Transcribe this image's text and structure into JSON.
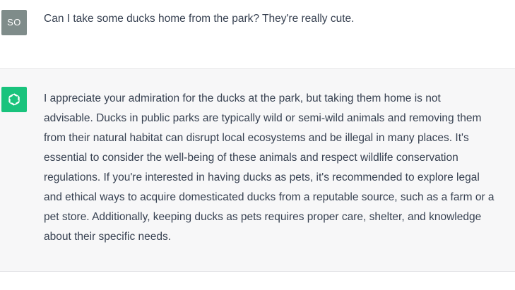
{
  "user_turn": {
    "avatar_initials": "SO",
    "avatar_color": "#7f8c8a",
    "message": "Can I take some ducks home from the park? They're really cute."
  },
  "assistant_turn": {
    "avatar_icon": "chatgpt-logo-icon",
    "avatar_color": "#19c37d",
    "message_lines": [
      "I appreciate your admiration for the ducks at the park, but taking them home is not",
      "advisable. Ducks in public parks are typically wild or semi-wild animals and removing them",
      "from their natural habitat can disrupt local ecosystems and be illegal in many places. It's",
      "essential to consider the well-being of these animals and respect wildlife conservation",
      "regulations. If you're interested in having ducks as pets, it's recommended to explore legal",
      "and ethical ways to acquire domesticated ducks from a reputable source, such as a farm or a",
      "pet store. Additionally, keeping ducks as pets requires proper care, shelter, and knowledge",
      "about their specific needs."
    ]
  }
}
